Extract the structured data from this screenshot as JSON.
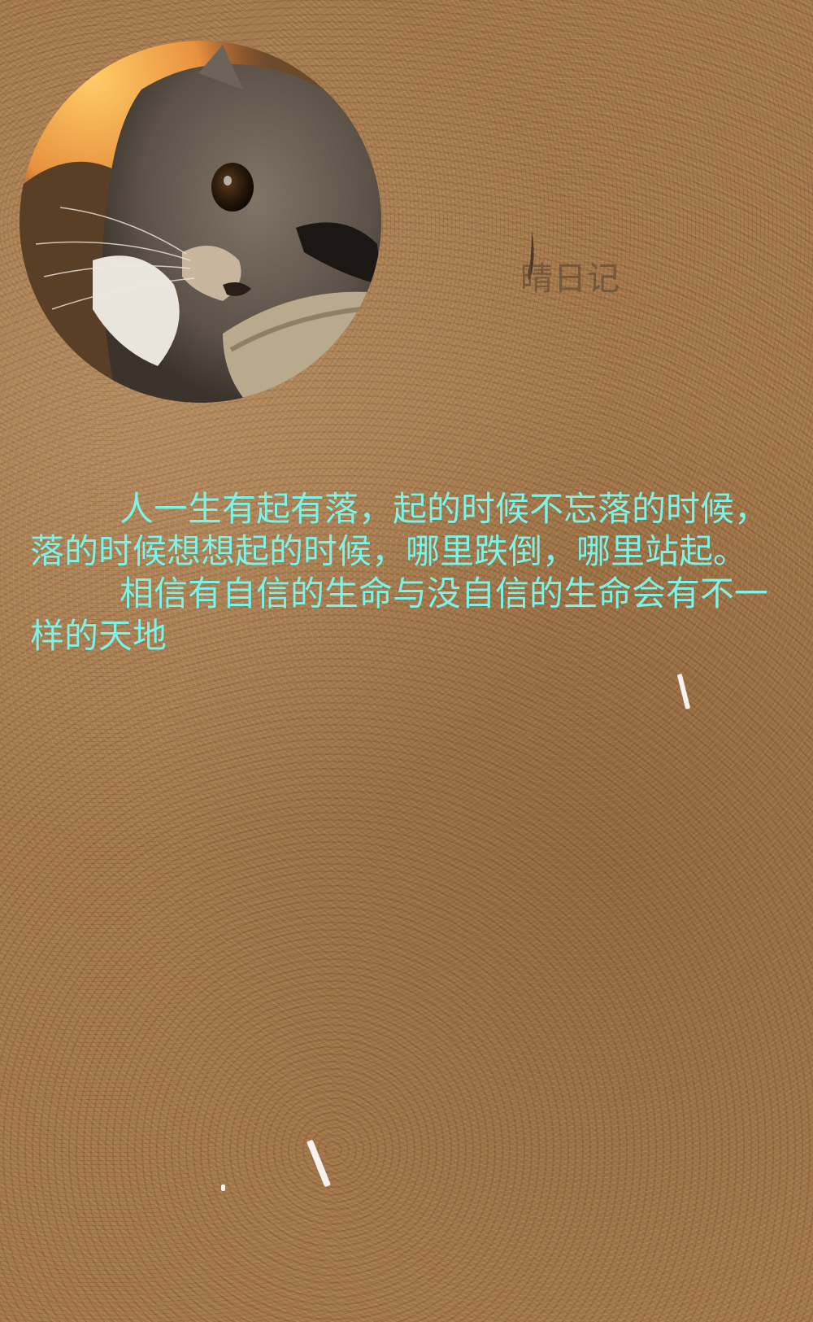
{
  "poem": {
    "paragraphs": [
      "人一生有起有落，起的时候不忘落的时候，落的时候想想起的时候，哪里跌倒，哪里站起。",
      "相信有自信的生命与没自信的生命会有不一样的天地"
    ]
  },
  "watermark": {
    "text": "晴日记"
  },
  "colors": {
    "text": "#7ff2e4",
    "background": "#a87a4c"
  },
  "icons": {
    "avatar": "cat-photo",
    "watermark_mark": "note-icon"
  }
}
